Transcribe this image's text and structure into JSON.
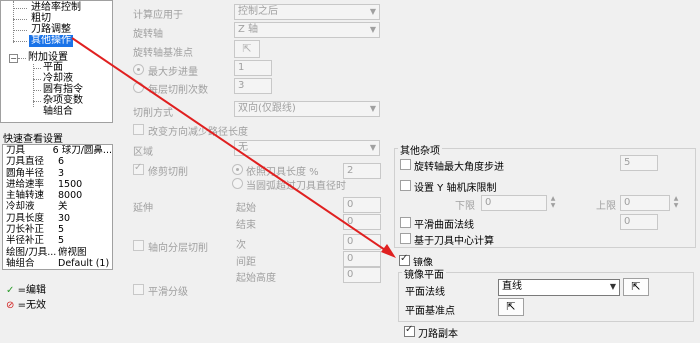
{
  "tree": {
    "items": [
      {
        "label": "进给率控制"
      },
      {
        "label": "粗切"
      },
      {
        "label": "刀路调整"
      },
      {
        "label": "其他操作"
      },
      {
        "label": "附加设置"
      },
      {
        "label": "平面"
      },
      {
        "label": "冷却液"
      },
      {
        "label": "圆有指令"
      },
      {
        "label": "杂项变数"
      },
      {
        "label": "轴组合"
      }
    ]
  },
  "quick_view": {
    "title": "快速查看设置",
    "rows": [
      {
        "key": "刀具",
        "value": "6 球刀/圆鼻..."
      },
      {
        "key": "刀具直径",
        "value": "6"
      },
      {
        "key": "圆角半径",
        "value": "3"
      },
      {
        "key": "进给速率",
        "value": "1500"
      },
      {
        "key": "主轴转速",
        "value": "8000"
      },
      {
        "key": "冷却液",
        "value": "关"
      },
      {
        "key": "刀具长度",
        "value": "30"
      },
      {
        "key": "刀长补正",
        "value": "5"
      },
      {
        "key": "半径补正",
        "value": "5"
      },
      {
        "key": "绘图/刀具...",
        "value": "俯视图"
      },
      {
        "key": "轴组合",
        "value": "Default (1)"
      }
    ]
  },
  "legend": {
    "edit": "=编辑",
    "invalid": "=无效"
  },
  "main": {
    "calc_label": "计算应用于",
    "calc_value": "控制之后",
    "rot_axis_label": "旋转轴",
    "rot_axis_value": "Z 轴",
    "rot_base_label": "旋转轴基准点",
    "max_step_label": "最大步进量",
    "max_step_value": "1",
    "layer_label": "每层切削次数",
    "layer_value": "3",
    "cut_mode_label": "切削方式",
    "cut_mode_value": "双向(仅跟线)",
    "reduce_label": "改变方向减少路径长度",
    "region_label": "区域",
    "region_value": "无",
    "trim_label": "修剪切削",
    "trim_opt1": "依照刀具长度 %",
    "trim_opt1_value": "2",
    "trim_opt2": "当圆弧超过刀具直径时",
    "extend_label": "延伸",
    "start_label": "起始",
    "start_value": "0",
    "end_label": "结束",
    "end_value": "0",
    "axial_label": "轴向分层切削",
    "count_label": "次",
    "count_value": "0",
    "spacing_label": "间距",
    "spacing_value": "0",
    "start_height_label": "起始高度",
    "start_height_value": "0",
    "smooth_layer_label": "平滑分级"
  },
  "misc": {
    "title": "其他杂项",
    "max_angle_label": "旋转轴最大角度步进",
    "max_angle_value": "5",
    "y_limit_label": "设置 Y 轴机床限制",
    "lower_label": "下限",
    "lower_value": "0",
    "upper_label": "上限",
    "upper_value": "0",
    "smooth_normal_label": "平滑曲面法线",
    "smooth_normal_value": "0",
    "tool_center_label": "基于刀具中心计算"
  },
  "mirror": {
    "title": "镜像",
    "plane_group_title": "镜像平面",
    "plane_normal_label": "平面法线",
    "plane_normal_value": "直线",
    "plane_base_label": "平面基准点",
    "toolpath_copy_label": "刀路副本"
  },
  "colors": {
    "selection": "#1a73e8",
    "arrow": "#e02020",
    "edit_check": "#2e9d2e",
    "invalid_icon": "#d02020"
  }
}
